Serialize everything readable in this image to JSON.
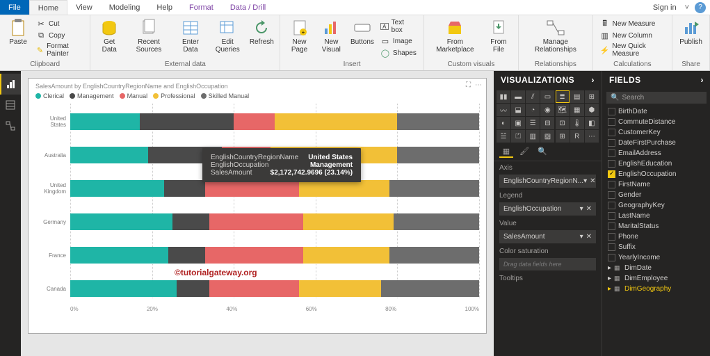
{
  "titlebar": {
    "tabs": [
      "File",
      "Home",
      "View",
      "Modeling",
      "Help",
      "Format",
      "Data / Drill"
    ],
    "signin": "Sign in"
  },
  "ribbon": {
    "clipboard": {
      "paste": "Paste",
      "cut": "Cut",
      "copy": "Copy",
      "painter": "Format Painter",
      "label": "Clipboard"
    },
    "external": {
      "get": "Get\nData",
      "recent": "Recent\nSources",
      "enter": "Enter\nData",
      "edit": "Edit\nQueries",
      "refresh": "Refresh",
      "label": "External data"
    },
    "insert": {
      "newpage": "New\nPage",
      "newvisual": "New\nVisual",
      "buttons": "Buttons",
      "textbox": "Text box",
      "image": "Image",
      "shapes": "Shapes",
      "label": "Insert"
    },
    "custom": {
      "market": "From\nMarketplace",
      "file": "From\nFile",
      "label": "Custom visuals"
    },
    "rel": {
      "manage": "Manage\nRelationships",
      "label": "Relationships"
    },
    "calc": {
      "measure": "New Measure",
      "column": "New Column",
      "quick": "New Quick Measure",
      "label": "Calculations"
    },
    "share": {
      "publish": "Publish",
      "label": "Share"
    }
  },
  "chart_data": {
    "type": "bar",
    "title": "SalesAmount by EnglishCountryRegionName and EnglishOccupation",
    "legend": [
      "Clerical",
      "Management",
      "Manual",
      "Professional",
      "Skilled Manual"
    ],
    "colors": [
      "#1fb5a6",
      "#4a4a4a",
      "#e76767",
      "#f2c037",
      "#6d6d6d"
    ],
    "categories": [
      "United States",
      "Australia",
      "United Kingdom",
      "Germany",
      "France",
      "Canada"
    ],
    "series": [
      {
        "name": "Clerical",
        "values": [
          17,
          19,
          23,
          25,
          24,
          26
        ]
      },
      {
        "name": "Management",
        "values": [
          23,
          18,
          10,
          9,
          9,
          8
        ]
      },
      {
        "name": "Manual",
        "values": [
          10,
          12,
          23,
          23,
          24,
          22
        ]
      },
      {
        "name": "Professional",
        "values": [
          30,
          31,
          22,
          22,
          21,
          20
        ]
      },
      {
        "name": "Skilled Manual",
        "values": [
          20,
          20,
          22,
          21,
          22,
          24
        ]
      }
    ],
    "xticks": [
      "0%",
      "20%",
      "40%",
      "60%",
      "80%",
      "100%"
    ]
  },
  "tooltip": {
    "k1": "EnglishCountryRegionName",
    "v1": "United States",
    "k2": "EnglishOccupation",
    "v2": "Management",
    "k3": "SalesAmount",
    "v3": "$2,172,742.9696 (23.14%)"
  },
  "watermark": "©tutorialgateway.org",
  "vis": {
    "header": "VISUALIZATIONS",
    "wells": {
      "axis": "Axis",
      "axis_val": "EnglishCountryRegionN...",
      "legend": "Legend",
      "legend_val": "EnglishOccupation",
      "value": "Value",
      "value_val": "SalesAmount",
      "sat": "Color saturation",
      "sat_val": "Drag data fields here",
      "tooltips": "Tooltips"
    }
  },
  "fields": {
    "header": "FIELDS",
    "search": "Search",
    "items": [
      "BirthDate",
      "CommuteDistance",
      "CustomerKey",
      "DateFirstPurchase",
      "EmailAddress",
      "EnglishEducation",
      "EnglishOccupation",
      "FirstName",
      "Gender",
      "GeographyKey",
      "LastName",
      "MaritalStatus",
      "Phone",
      "Suffix",
      "YearlyIncome"
    ],
    "checked": [
      "EnglishOccupation"
    ],
    "tables": [
      "DimDate",
      "DimEmployee",
      "DimGeography"
    ]
  }
}
